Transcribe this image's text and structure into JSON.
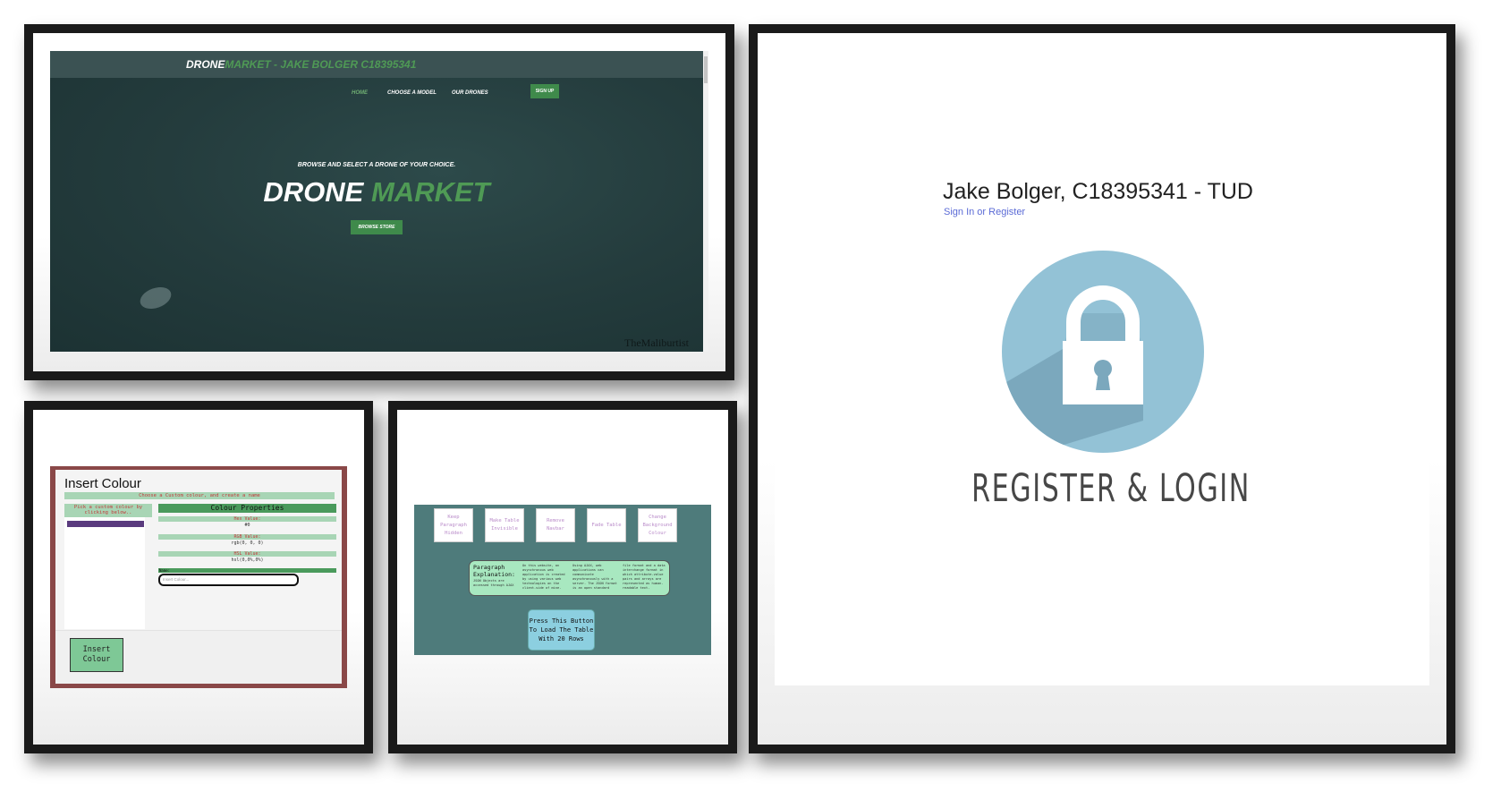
{
  "drone_market": {
    "brand_white": "DRONE",
    "brand_green": "MARKET - JAKE BOLGER C18395341",
    "nav": [
      "HOME",
      "CHOOSE A MODEL",
      "OUR DRONES"
    ],
    "signup_label": "SIGN UP",
    "tagline": "BROWSE AND SELECT A DRONE OF YOUR CHOICE.",
    "hero_white": "DRONE",
    "hero_green": "MARKET",
    "browse_label": "BROWSE STORE",
    "watermark": "TheMaliburtist",
    "colors": {
      "accent": "#4f9a55",
      "background": "#243c3d"
    }
  },
  "insert_colour": {
    "title": "Insert Colour",
    "subtitle": "Choose a Custom colour, and create a name",
    "pick_text": "Pick a custom colour by clicking below..",
    "swatch_color": "#5a3b7e",
    "properties_header": "Colour Properties",
    "hex_label": "Hex Value:",
    "hex_value": "#0",
    "rgb_label": "RGB Value:",
    "rgb_value": "rgb(0, 0, 0)",
    "hsl_label": "HSL Value:",
    "hsl_value": "hsl(0,0%,0%)",
    "name_label": "Name:",
    "name_placeholder": "Insert Colour...",
    "insert_button": "Insert Colour"
  },
  "table_controls": {
    "buttons": [
      "Keep Paragraph Hidden",
      "Make Table Invisible",
      "Remove Navbar",
      "Fade Table",
      "Change Background Colour"
    ],
    "paragraph_title": "Paragraph Explanation:",
    "paragraph_cols": [
      "JSON Objects are accessed through AJAX",
      "On this website, an asynchronous web application is created by using various web technologies on the client-side of mine.",
      "Using AJAX, web applications can communicate asynchronously with a server. The JSON format is an open standard",
      "file format and a data interchange format in which attribute-value pairs and arrays are represented as human-readable text."
    ],
    "load_button": "Press This Button To Load The Table With 20 Rows"
  },
  "register_login": {
    "title": "Jake Bolger, C18395341 - TUD",
    "subtitle": "Sign In or Register",
    "caption": "REGISTER & LOGIN",
    "icon": "padlock-icon",
    "colors": {
      "circle": "#93c2d6",
      "shadow": "#7ba8bd"
    }
  }
}
